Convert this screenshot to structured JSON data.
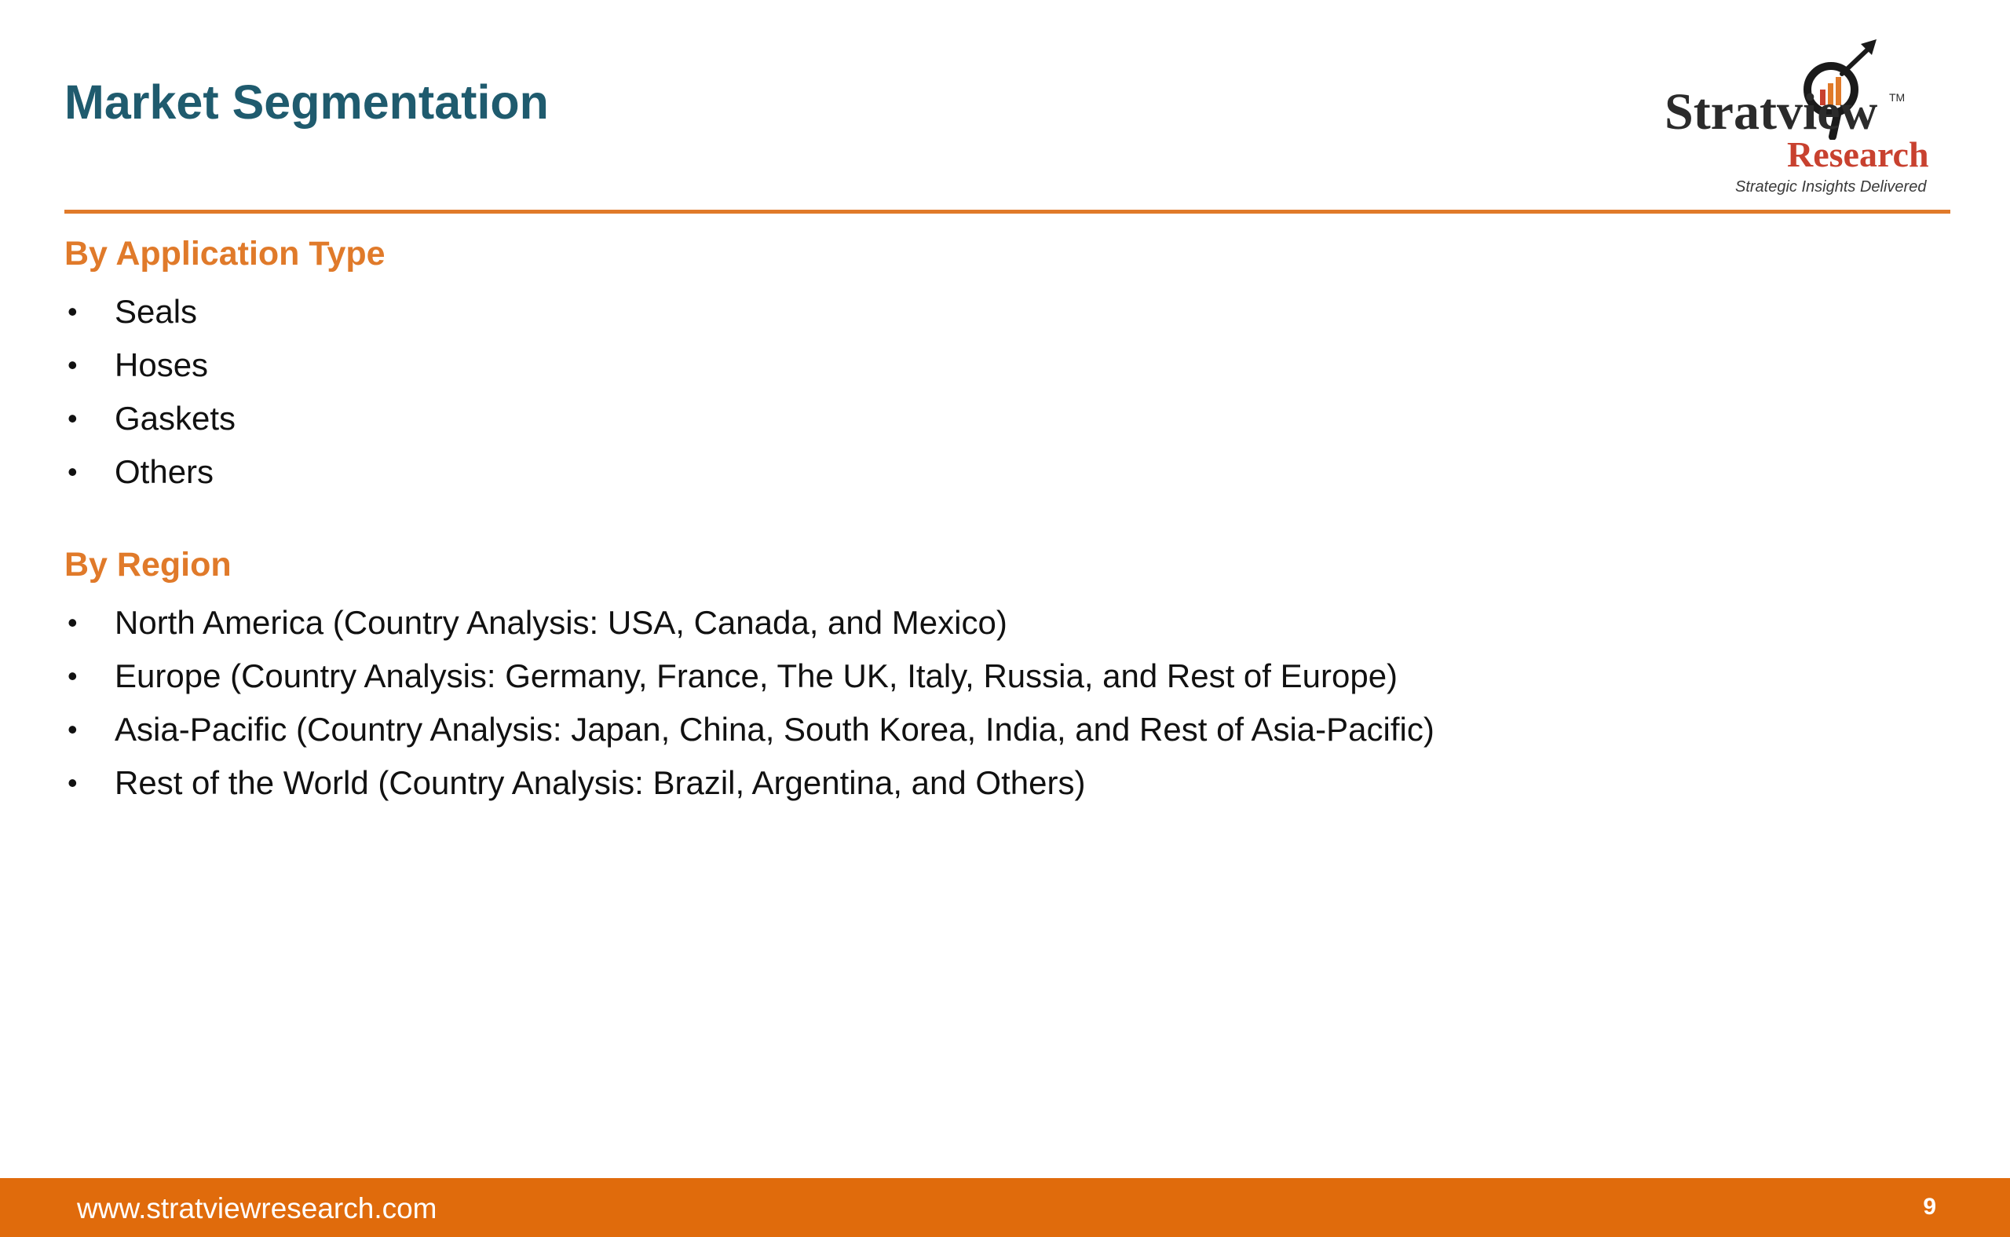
{
  "slide": {
    "title": "Market Segmentation",
    "page_number": "9"
  },
  "logo": {
    "word": "Stratview",
    "tm": "TM",
    "research": "Research",
    "tagline": "Strategic Insights Delivered",
    "colors": {
      "dark": "#2b2b2b",
      "red": "#c8412f",
      "orange": "#e07a2a"
    }
  },
  "sections": [
    {
      "heading": "By Application Type",
      "items": [
        "Seals",
        "Hoses",
        "Gaskets",
        "Others"
      ]
    },
    {
      "heading": "By Region",
      "items": [
        "North America (Country Analysis: USA, Canada, and Mexico)",
        "Europe (Country Analysis: Germany, France, The UK, Italy, Russia, and Rest of Europe)",
        "Asia-Pacific (Country Analysis: Japan, China, South Korea, India, and Rest of Asia-Pacific)",
        "Rest of the World (Country Analysis: Brazil, Argentina, and Others)"
      ]
    }
  ],
  "footer": {
    "url": "www.stratviewresearch.com"
  },
  "theme": {
    "title_color": "#1f5b6e",
    "accent_color": "#e07a2a",
    "footer_color": "#e06b0c",
    "bullet_glyph": "•"
  }
}
